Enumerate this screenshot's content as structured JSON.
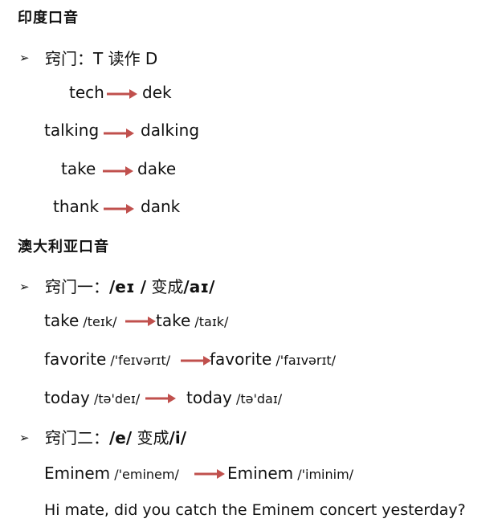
{
  "indian": {
    "title": "印度口音",
    "tip_prefix": "窍门：",
    "tip_rest": "T 读作 D",
    "examples": [
      {
        "from": "tech",
        "to": "dek"
      },
      {
        "from": "talking",
        "to": "dalking"
      },
      {
        "from": "take",
        "to": "dake"
      },
      {
        "from": "thank",
        "to": "dank"
      }
    ]
  },
  "australian": {
    "title": "澳大利亚口音",
    "tip1_prefix": "窍门一：",
    "tip1_a": "/eɪ /",
    "tip1_mid": "变成",
    "tip1_b": "/aɪ/",
    "ex1": [
      {
        "word": "take",
        "ph1": "/teɪk/",
        "word2": "take",
        "ph2": "/taɪk/"
      },
      {
        "word": "favorite",
        "ph1": "/'feɪvərɪt/",
        "word2": "favorite",
        "ph2": "/'faɪvərɪt/"
      },
      {
        "word": "today",
        "ph1": "/tə'deɪ/",
        "word2": "today",
        "ph2": "/tə'daɪ/"
      }
    ],
    "tip2_prefix": "窍门二：",
    "tip2_a": "/e/",
    "tip2_mid": "变成",
    "tip2_b": "/i/",
    "ex2": {
      "word": "Eminem",
      "ph1": "/'eminem/",
      "word2": "Eminem",
      "ph2": "/'iminim/"
    },
    "sentence": "Hi mate, did you catch the Eminem concert yesterday?"
  },
  "bullet_glyph": "➢",
  "arrow_color": "#c0504d"
}
